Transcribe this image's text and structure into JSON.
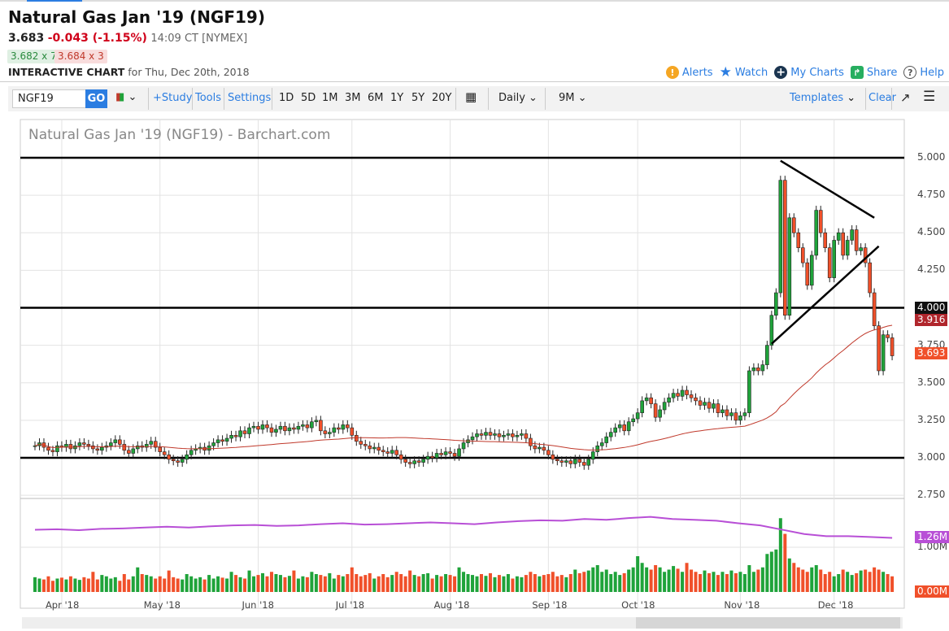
{
  "header": {
    "title": "Natural Gas Jan '19 (NGF19)",
    "last": "3.683",
    "change": "-0.043 (-1.15%)",
    "time": "14:09 CT [NYMEX]",
    "bid": "3.682 x 7",
    "ask": "3.684 x 3",
    "chart_label": "INTERACTIVE CHART",
    "chart_date": "for Thu, Dec 20th, 2018",
    "links": [
      {
        "label": "Alerts",
        "icon": "alert-icon"
      },
      {
        "label": "Watch",
        "icon": "star-icon"
      },
      {
        "label": "My Charts",
        "icon": "plus-circle-icon"
      },
      {
        "label": "Share",
        "icon": "share-icon"
      },
      {
        "label": "Help",
        "icon": "help-icon"
      }
    ]
  },
  "toolbar": {
    "symbol": "NGF19",
    "go": "GO",
    "study": "+Study",
    "tools": "Tools",
    "settings": "Settings",
    "periods": [
      "1D",
      "5D",
      "1M",
      "3M",
      "6M",
      "1Y",
      "5Y",
      "20Y"
    ],
    "interval": "Daily",
    "range": "9M",
    "templates": "Templates",
    "clear": "Clear"
  },
  "chart_data": {
    "type": "candlestick",
    "title": "Natural Gas Jan '19 (NGF19) - Barchart.com",
    "ylim": [
      2.75,
      5.0
    ],
    "y_ticks": [
      "5.000",
      "4.750",
      "4.500",
      "4.250",
      "4.000",
      "3.750",
      "3.500",
      "3.250",
      "3.000",
      "2.750"
    ],
    "horizontal_lines": [
      5.0,
      4.0,
      3.0
    ],
    "price_labels": [
      {
        "value": "4.000",
        "color": "#111111"
      },
      {
        "value": "3.916",
        "color": "#b0262c"
      },
      {
        "value": "3.693",
        "color": "#f0502a"
      }
    ],
    "months": [
      {
        "label": "Apr '18",
        "index": 6
      },
      {
        "label": "May '18",
        "index": 28
      },
      {
        "label": "Jun '18",
        "index": 50
      },
      {
        "label": "Jul '18",
        "index": 71
      },
      {
        "label": "Aug '18",
        "index": 93
      },
      {
        "label": "Sep '18",
        "index": 115
      },
      {
        "label": "Oct '18",
        "index": 135
      },
      {
        "label": "Nov '18",
        "index": 158
      },
      {
        "label": "Dec '18",
        "index": 179
      }
    ],
    "close": [
      3.08,
      3.1,
      3.07,
      3.05,
      3.04,
      3.08,
      3.07,
      3.09,
      3.06,
      3.08,
      3.1,
      3.09,
      3.08,
      3.06,
      3.05,
      3.07,
      3.08,
      3.1,
      3.12,
      3.09,
      3.05,
      3.03,
      3.06,
      3.08,
      3.07,
      3.09,
      3.11,
      3.07,
      3.04,
      3.02,
      2.99,
      2.98,
      2.97,
      2.99,
      3.02,
      3.05,
      3.06,
      3.07,
      3.05,
      3.08,
      3.1,
      3.12,
      3.11,
      3.13,
      3.15,
      3.14,
      3.18,
      3.16,
      3.2,
      3.21,
      3.19,
      3.22,
      3.2,
      3.17,
      3.19,
      3.21,
      3.18,
      3.2,
      3.19,
      3.21,
      3.22,
      3.2,
      3.24,
      3.25,
      3.18,
      3.16,
      3.17,
      3.2,
      3.19,
      3.22,
      3.2,
      3.15,
      3.11,
      3.09,
      3.08,
      3.06,
      3.07,
      3.05,
      3.04,
      3.03,
      3.05,
      3.02,
      2.99,
      2.97,
      2.96,
      2.98,
      2.97,
      2.99,
      3.01,
      3.0,
      3.03,
      3.02,
      3.04,
      3.03,
      3.01,
      3.06,
      3.1,
      3.12,
      3.14,
      3.16,
      3.15,
      3.17,
      3.15,
      3.16,
      3.14,
      3.15,
      3.16,
      3.14,
      3.15,
      3.16,
      3.13,
      3.08,
      3.06,
      3.07,
      3.05,
      3.02,
      2.99,
      2.98,
      2.97,
      2.98,
      2.96,
      2.99,
      2.97,
      2.95,
      2.99,
      3.04,
      3.08,
      3.1,
      3.14,
      3.17,
      3.2,
      3.22,
      3.18,
      3.24,
      3.26,
      3.3,
      3.38,
      3.4,
      3.36,
      3.27,
      3.32,
      3.37,
      3.4,
      3.43,
      3.41,
      3.45,
      3.42,
      3.4,
      3.38,
      3.35,
      3.37,
      3.33,
      3.36,
      3.3,
      3.32,
      3.28,
      3.3,
      3.25,
      3.28,
      3.3,
      3.58,
      3.6,
      3.58,
      3.62,
      3.75,
      3.95,
      4.1,
      4.85,
      3.95,
      4.6,
      4.5,
      4.4,
      4.3,
      4.15,
      4.35,
      4.65,
      4.5,
      4.4,
      4.2,
      4.45,
      4.5,
      4.35,
      4.45,
      4.52,
      4.38,
      4.4,
      4.3,
      4.1,
      3.88,
      3.58,
      3.82,
      3.8,
      3.68
    ],
    "volume_ylim": [
      "0.00M",
      "1.00M"
    ],
    "volume_m": [
      0.33,
      0.3,
      0.28,
      0.35,
      0.25,
      0.3,
      0.32,
      0.28,
      0.35,
      0.3,
      0.27,
      0.33,
      0.3,
      0.45,
      0.28,
      0.38,
      0.35,
      0.3,
      0.33,
      0.25,
      0.4,
      0.28,
      0.35,
      0.55,
      0.4,
      0.38,
      0.35,
      0.3,
      0.35,
      0.3,
      0.48,
      0.33,
      0.3,
      0.28,
      0.4,
      0.35,
      0.3,
      0.33,
      0.28,
      0.38,
      0.3,
      0.35,
      0.32,
      0.3,
      0.45,
      0.38,
      0.33,
      0.3,
      0.48,
      0.35,
      0.38,
      0.42,
      0.35,
      0.45,
      0.4,
      0.38,
      0.33,
      0.36,
      0.48,
      0.3,
      0.35,
      0.33,
      0.45,
      0.4,
      0.38,
      0.35,
      0.42,
      0.3,
      0.38,
      0.35,
      0.4,
      0.55,
      0.4,
      0.35,
      0.38,
      0.42,
      0.3,
      0.35,
      0.4,
      0.33,
      0.38,
      0.45,
      0.4,
      0.35,
      0.48,
      0.38,
      0.35,
      0.4,
      0.42,
      0.3,
      0.38,
      0.35,
      0.4,
      0.38,
      0.35,
      0.55,
      0.45,
      0.4,
      0.38,
      0.35,
      0.4,
      0.36,
      0.42,
      0.33,
      0.38,
      0.35,
      0.4,
      0.3,
      0.35,
      0.33,
      0.38,
      0.45,
      0.4,
      0.35,
      0.38,
      0.4,
      0.45,
      0.35,
      0.38,
      0.33,
      0.4,
      0.5,
      0.42,
      0.45,
      0.48,
      0.55,
      0.6,
      0.45,
      0.5,
      0.4,
      0.45,
      0.38,
      0.42,
      0.5,
      0.55,
      0.8,
      0.65,
      0.55,
      0.5,
      0.6,
      0.55,
      0.45,
      0.5,
      0.58,
      0.52,
      0.45,
      0.65,
      0.5,
      0.45,
      0.4,
      0.48,
      0.42,
      0.45,
      0.38,
      0.45,
      0.4,
      0.48,
      0.42,
      0.45,
      0.4,
      0.6,
      0.45,
      0.5,
      0.55,
      0.85,
      0.9,
      0.95,
      1.65,
      1.3,
      0.75,
      0.65,
      0.55,
      0.5,
      0.45,
      0.55,
      0.6,
      0.5,
      0.4,
      0.45,
      0.35,
      0.4,
      0.5,
      0.45,
      0.38,
      0.42,
      0.48,
      0.5,
      0.45,
      0.55,
      0.5,
      0.45,
      0.4,
      0.35
    ],
    "open_interest_weekly_m": [
      1.45,
      1.46,
      1.44,
      1.47,
      1.48,
      1.5,
      1.52,
      1.5,
      1.53,
      1.55,
      1.56,
      1.54,
      1.55,
      1.58,
      1.6,
      1.57,
      1.58,
      1.6,
      1.62,
      1.6,
      1.58,
      1.62,
      1.65,
      1.67,
      1.66,
      1.7,
      1.68,
      1.72,
      1.75,
      1.7,
      1.68,
      1.66,
      1.6,
      1.55,
      1.45,
      1.35,
      1.3,
      1.3,
      1.28,
      1.26
    ],
    "open_interest_label": "1.26M",
    "moving_average_period": 50,
    "trendlines": [
      {
        "from": {
          "index": 167,
          "price": 4.98
        },
        "to": {
          "index": 188,
          "price": 4.6
        }
      },
      {
        "from": {
          "index": 165,
          "price": 3.76
        },
        "to": {
          "index": 189,
          "price": 4.41
        }
      }
    ],
    "colors": {
      "up": "#1fa33a",
      "down": "#f0502a",
      "ma": "#c0392b",
      "oi": "#b84fd6"
    }
  }
}
